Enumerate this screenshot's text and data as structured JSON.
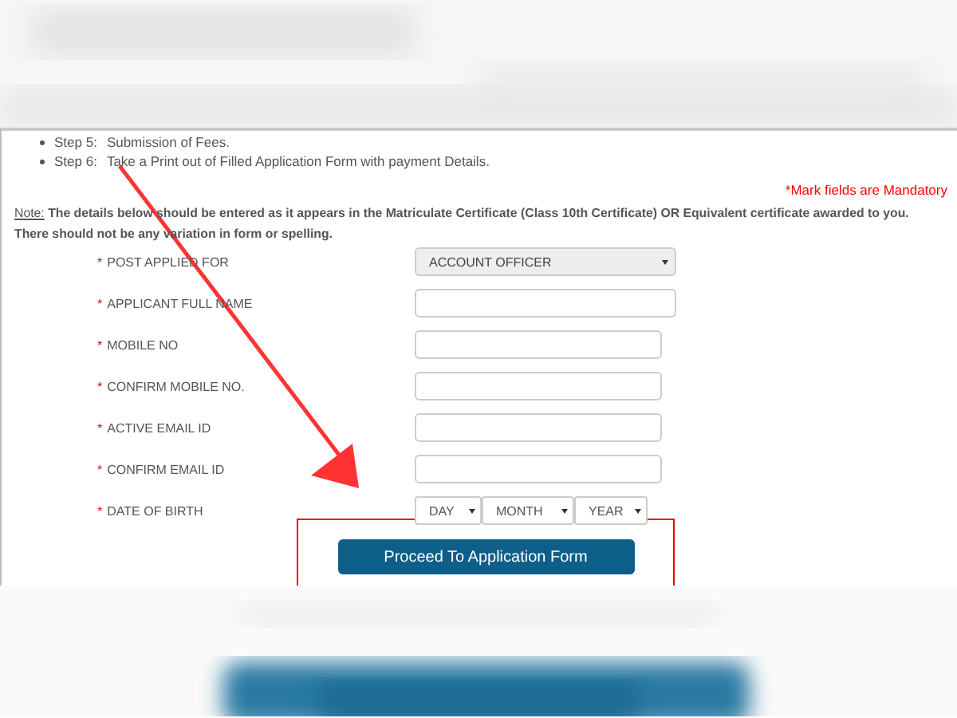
{
  "steps": [
    {
      "label": "Step 5:",
      "text": "Submission of Fees."
    },
    {
      "label": "Step 6:",
      "text": "Take a Print out of Filled Application Form with payment Details."
    }
  ],
  "mandatory_note": "*Mark fields are Mandatory",
  "note": {
    "label": "Note:",
    "text": "The details below should be entered as it appears in the Matriculate Certificate (Class 10th Certificate) OR Equivalent certificate awarded to you. There should not be any variation in form or spelling."
  },
  "fields": [
    {
      "kind": "select",
      "required_mark": "*",
      "label": "POST APPLIED FOR",
      "value": "ACCOUNT OFFICER"
    },
    {
      "kind": "text",
      "required_mark": "*",
      "label": "APPLICANT FULL NAME",
      "wide": true
    },
    {
      "kind": "text",
      "required_mark": "*",
      "label": "MOBILE NO",
      "wide": false
    },
    {
      "kind": "text",
      "required_mark": "*",
      "label": "CONFIRM MOBILE NO.",
      "wide": false
    },
    {
      "kind": "text",
      "required_mark": "*",
      "label": "ACTIVE EMAIL ID",
      "wide": false
    },
    {
      "kind": "text",
      "required_mark": "*",
      "label": "CONFIRM EMAIL ID",
      "wide": false
    },
    {
      "kind": "date",
      "required_mark": "*",
      "label": "DATE OF BIRTH",
      "parts": [
        "DAY",
        "MONTH",
        "YEAR"
      ]
    }
  ],
  "button": "Proceed To Application Form"
}
